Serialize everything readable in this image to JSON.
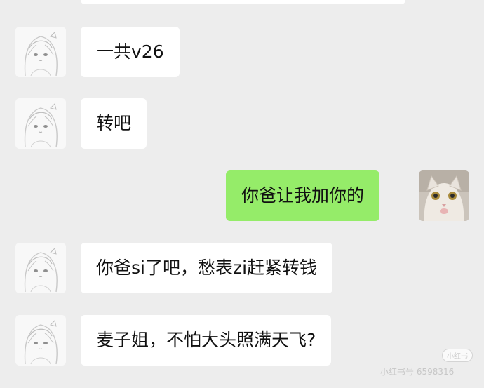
{
  "messages": [
    {
      "sender": "other",
      "text": "一共v26"
    },
    {
      "sender": "other",
      "text": "转吧"
    },
    {
      "sender": "self",
      "text": "你爸让我加你的"
    },
    {
      "sender": "other",
      "text": "你爸si了吧，愁表zi赶紧转钱"
    },
    {
      "sender": "other",
      "text": "麦子姐，不怕大头照满天飞?"
    }
  ],
  "avatars": {
    "other": "anime-girl-sketch-avatar",
    "self": "cat-avatar"
  },
  "colors": {
    "background": "#ededed",
    "incoming_bubble": "#ffffff",
    "outgoing_bubble": "#95ec69"
  },
  "watermark": {
    "badge": "小红书",
    "text": "小红书号 6598316"
  }
}
